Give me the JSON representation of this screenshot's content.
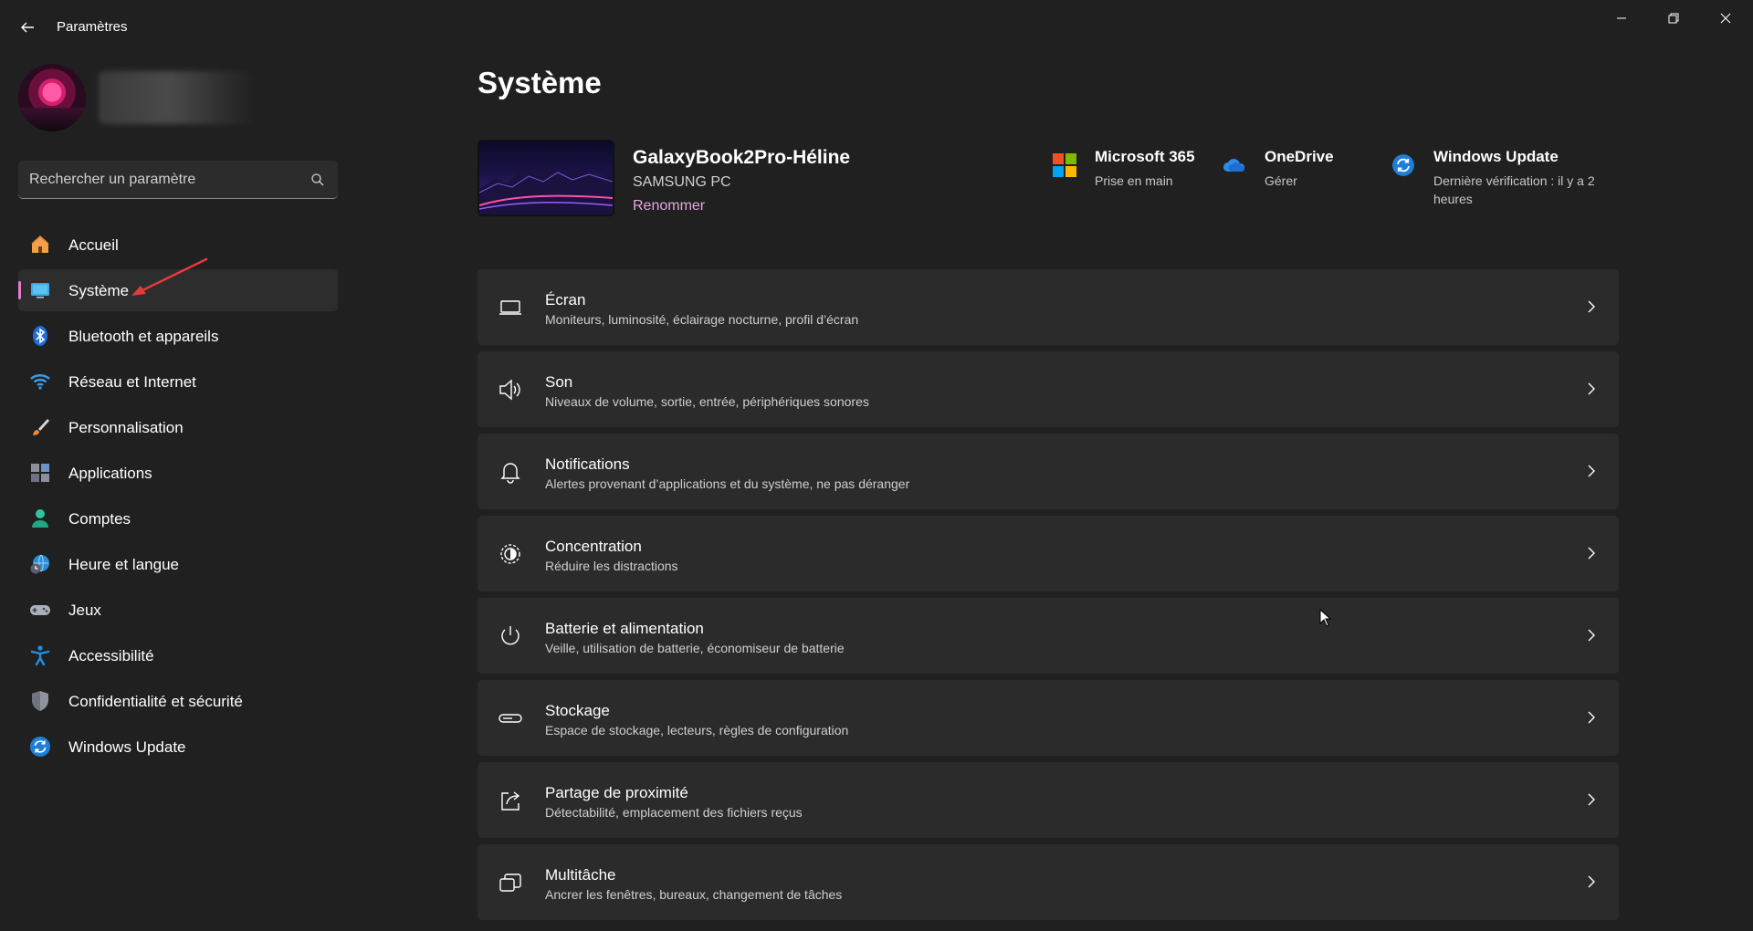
{
  "window": {
    "title": "Paramètres"
  },
  "search": {
    "placeholder": "Rechercher un paramètre"
  },
  "sidebar": {
    "items": [
      {
        "label": "Accueil",
        "icon": "home-icon"
      },
      {
        "label": "Système",
        "icon": "system-icon",
        "active": true
      },
      {
        "label": "Bluetooth et appareils",
        "icon": "bluetooth-icon"
      },
      {
        "label": "Réseau et Internet",
        "icon": "wifi-icon"
      },
      {
        "label": "Personnalisation",
        "icon": "brush-icon"
      },
      {
        "label": "Applications",
        "icon": "apps-icon"
      },
      {
        "label": "Comptes",
        "icon": "account-icon"
      },
      {
        "label": "Heure et langue",
        "icon": "globe-clock-icon"
      },
      {
        "label": "Jeux",
        "icon": "gamepad-icon"
      },
      {
        "label": "Accessibilité",
        "icon": "accessibility-icon"
      },
      {
        "label": "Confidentialité et sécurité",
        "icon": "shield-icon"
      },
      {
        "label": "Windows Update",
        "icon": "windows-update-icon"
      }
    ]
  },
  "main": {
    "title": "Système",
    "device": {
      "name": "GalaxyBook2Pro-Héline",
      "model": "SAMSUNG PC",
      "rename": "Renommer"
    },
    "quick_links": [
      {
        "title": "Microsoft 365",
        "subtitle": "Prise en main",
        "icon": "microsoft-365-icon"
      },
      {
        "title": "OneDrive",
        "subtitle": "Gérer",
        "icon": "onedrive-icon"
      },
      {
        "title": "Windows Update",
        "subtitle": "Dernière vérification : il y a 2 heures",
        "icon": "windows-update-icon"
      }
    ],
    "cards": [
      {
        "title": "Écran",
        "subtitle": "Moniteurs, luminosité, éclairage nocturne, profil d’écran",
        "icon": "display-icon"
      },
      {
        "title": "Son",
        "subtitle": "Niveaux de volume, sortie, entrée, périphériques sonores",
        "icon": "speaker-icon"
      },
      {
        "title": "Notifications",
        "subtitle": "Alertes provenant d’applications et du système, ne pas déranger",
        "icon": "bell-icon"
      },
      {
        "title": "Concentration",
        "subtitle": "Réduire les distractions",
        "icon": "focus-icon"
      },
      {
        "title": "Batterie et alimentation",
        "subtitle": "Veille, utilisation de batterie, économiseur de batterie",
        "icon": "power-icon"
      },
      {
        "title": "Stockage",
        "subtitle": "Espace de stockage, lecteurs, règles de configuration",
        "icon": "storage-icon"
      },
      {
        "title": "Partage de proximité",
        "subtitle": "Détectabilité, emplacement des fichiers reçus",
        "icon": "share-icon"
      },
      {
        "title": "Multitâche",
        "subtitle": "Ancrer les fenêtres, bureaux, changement de tâches",
        "icon": "multitask-icon"
      }
    ]
  },
  "colors": {
    "background": "#202020",
    "card": "#2b2b2b",
    "accent": "#e07fd0",
    "link": "#e6a6e0"
  }
}
